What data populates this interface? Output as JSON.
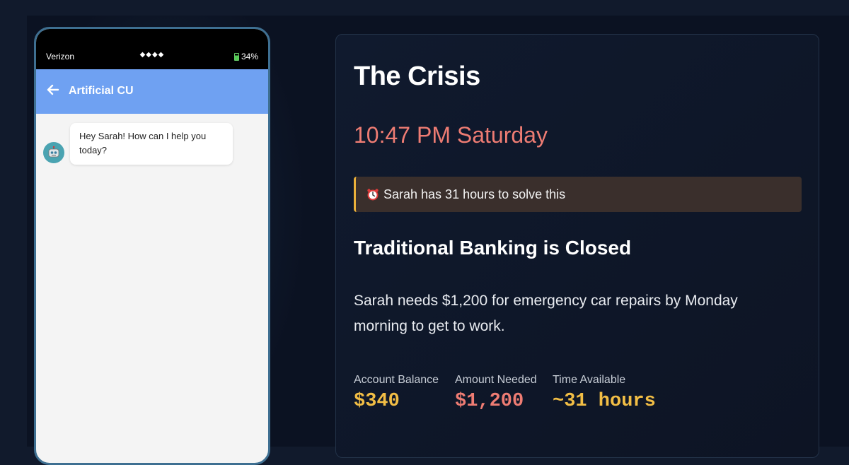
{
  "phone": {
    "status": {
      "carrier": "Verizon",
      "signal": "◆◆◆◆",
      "battery": "34%"
    },
    "header": {
      "title": "Artificial CU"
    },
    "messages": [
      {
        "from": "bot",
        "text": "Hey Sarah! How can I help you today?"
      }
    ]
  },
  "card": {
    "title": "The Crisis",
    "time": "10:47 PM Saturday",
    "alert": "Sarah has 31 hours to solve this",
    "heading": "Traditional Banking is Closed",
    "description": "Sarah needs $1,200 for emergency car repairs by Monday morning to get to work.",
    "stats": [
      {
        "label": "Account Balance",
        "value": "$340",
        "color": "#f2be45"
      },
      {
        "label": "Amount Needed",
        "value": "$1,200",
        "color": "#ee7c73"
      },
      {
        "label": "Time Available",
        "value": "~31 hours",
        "color": "#f2be45"
      }
    ]
  },
  "colors": {
    "accent_blue": "#6fa1f2",
    "alert_border": "#eab03a",
    "danger": "#ee7c73",
    "warning": "#f2be45"
  },
  "icons": {
    "back": "arrow-left-icon",
    "avatar": "robot-icon",
    "alert": "alarm-clock-icon",
    "battery": "battery-icon"
  }
}
